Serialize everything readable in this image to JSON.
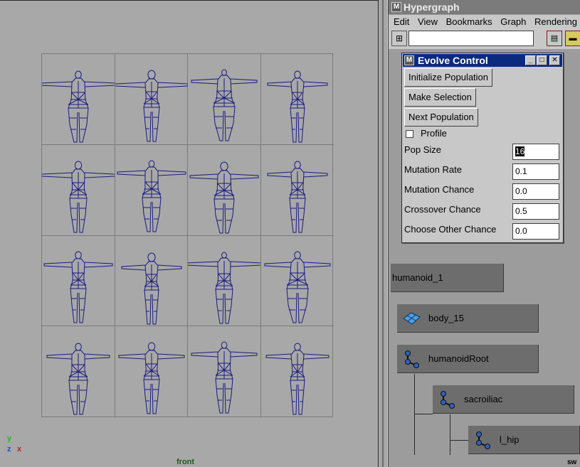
{
  "viewport": {
    "camera_label": "front",
    "axes": {
      "y": "y",
      "z": "z",
      "x": "x"
    },
    "figure_count": 16
  },
  "hypergraph": {
    "title": "Hypergraph",
    "menu": [
      "Edit",
      "View",
      "Bookmarks",
      "Graph",
      "Rendering"
    ],
    "search_value": "",
    "nodes": [
      {
        "label": "humanoid_1",
        "icon": "transform-icon"
      },
      {
        "label": "body_15",
        "icon": "mesh-icon"
      },
      {
        "label": "humanoidRoot",
        "icon": "joint-icon"
      },
      {
        "label": "sacroiliac",
        "icon": "joint-icon"
      },
      {
        "label": "l_hip",
        "icon": "joint-icon"
      }
    ],
    "corner_text": "sw"
  },
  "evolve": {
    "title": "Evolve Control",
    "buttons": {
      "init": "Initialize Population",
      "select": "Make Selection",
      "next": "Next Population"
    },
    "profile_label": "Profile",
    "profile_checked": false,
    "fields": [
      {
        "label": "Pop Size",
        "value": "16"
      },
      {
        "label": "Mutation Rate",
        "value": "0.1"
      },
      {
        "label": "Mutation Chance",
        "value": "0.0"
      },
      {
        "label": "Crossover Chance",
        "value": "0.5"
      },
      {
        "label": "Choose Other Chance",
        "value": "0.0"
      }
    ]
  },
  "colors": {
    "wireframe": "#1a1a80",
    "dialog_title": "#0a2a80",
    "axis_x": "#c02020",
    "axis_y": "#20c020",
    "axis_z": "#2050e0",
    "camera_label": "#1e5a1e"
  }
}
